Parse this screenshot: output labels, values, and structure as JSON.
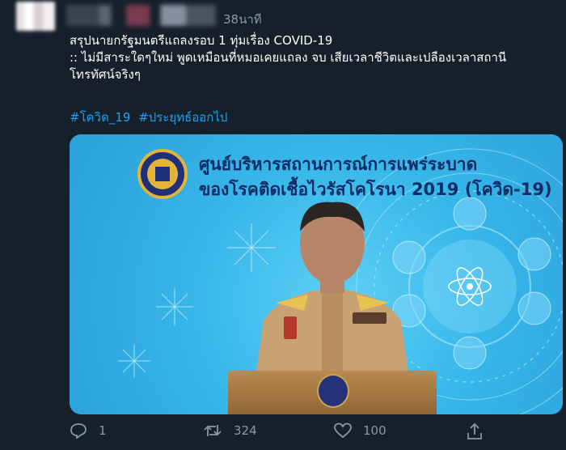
{
  "tweet": {
    "time": "38นาที",
    "text_lines": [
      "สรุปนายกรัฐมนตรีแถลงรอบ 1 ทุ่มเรื่อง COVID-19",
      ":: ไม่มีสาระใดๆใหม่ พูดเหมือนที่หมอเคยแถลง จบ เสียเวลาชีวิตและเปลืองเวลาสถานี",
      "โทรทัศน์จริงๆ"
    ],
    "hashtags": [
      "#โควิด_19",
      "#ประยุทธ์ออกไป"
    ]
  },
  "media": {
    "title_line1": "ศูนย์บริหารสถานการณ์การแพร่ระบาด",
    "title_line2": "ของโรคติดเชื้อไวรัสโคโรนา 2019 (โควิด-19)"
  },
  "actions": {
    "reply": {
      "icon": "reply-icon",
      "count": "1"
    },
    "retweet": {
      "icon": "retweet-icon",
      "count": "324"
    },
    "like": {
      "icon": "heart-icon",
      "count": "100"
    },
    "share": {
      "icon": "share-icon"
    }
  },
  "colors": {
    "background": "#15202b",
    "text": "#ffffff",
    "muted": "#8899a6",
    "link": "#1da1f2"
  }
}
